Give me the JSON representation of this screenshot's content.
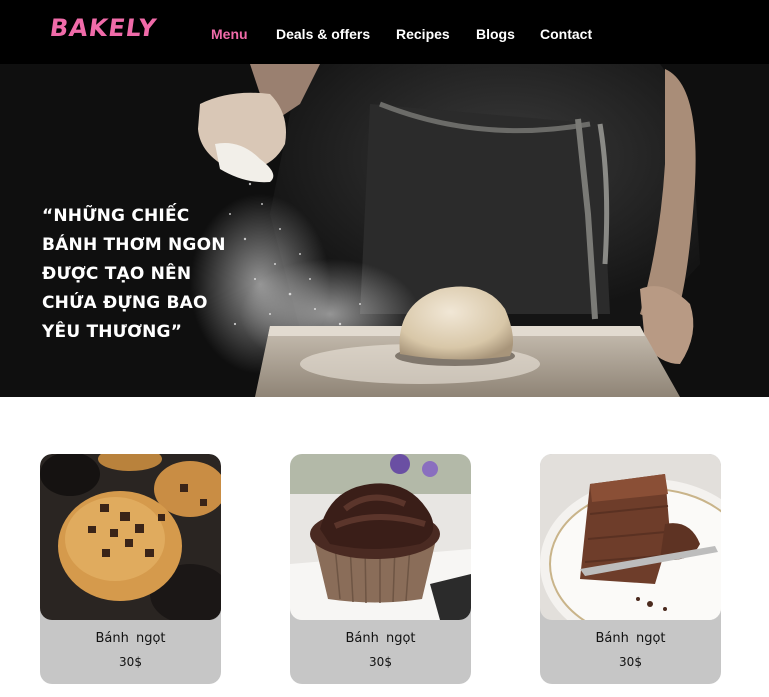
{
  "header": {
    "logo": "BAKELY",
    "nav": [
      {
        "label": "Menu",
        "active": true
      },
      {
        "label": "Deals & offers",
        "active": false
      },
      {
        "label": "Recipes",
        "active": false
      },
      {
        "label": "Blogs",
        "active": false
      },
      {
        "label": "Contact",
        "active": false
      }
    ]
  },
  "hero": {
    "quote_lines": [
      "“NHỮNG CHIẾC",
      "BÁNH THƠM NGON",
      "ĐƯỢC TẠO NÊN",
      "CHỨA ĐỰNG BAO",
      "YÊU THƯƠNG”"
    ]
  },
  "products": [
    {
      "name": "Bánh ngọt",
      "price": "30$",
      "image": "chocolate-chip-cookie"
    },
    {
      "name": "Bánh ngọt",
      "price": "30$",
      "image": "chocolate-cupcake"
    },
    {
      "name": "Bánh ngọt",
      "price": "30$",
      "image": "chocolate-cake-slice"
    }
  ],
  "colors": {
    "accent": "#f06ba9",
    "header_bg": "#000000",
    "card_bg": "#c6c6c6"
  }
}
